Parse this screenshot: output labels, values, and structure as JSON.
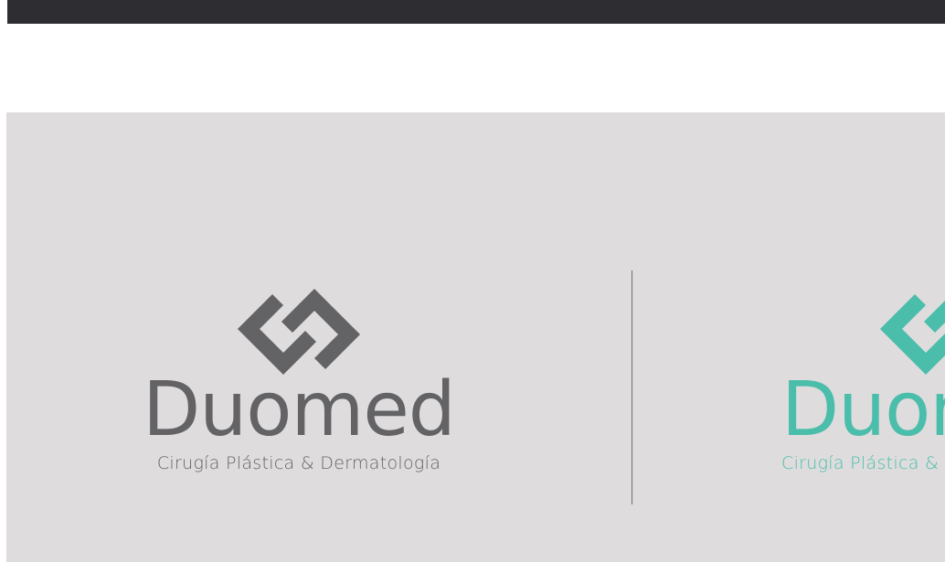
{
  "brand": {
    "name": "Duomed",
    "tagline": "Cirugía Plástica & Dermatología"
  },
  "variants": [
    {
      "name": "grey",
      "color": "#636265",
      "icon": "duomed-logo-mark"
    },
    {
      "name": "teal",
      "color": "#4bbdab",
      "icon": "duomed-logo-mark"
    }
  ],
  "colors": {
    "top_bar": "#2e2d32",
    "panel": "#dedcdd",
    "divider": "#6e6d70"
  }
}
